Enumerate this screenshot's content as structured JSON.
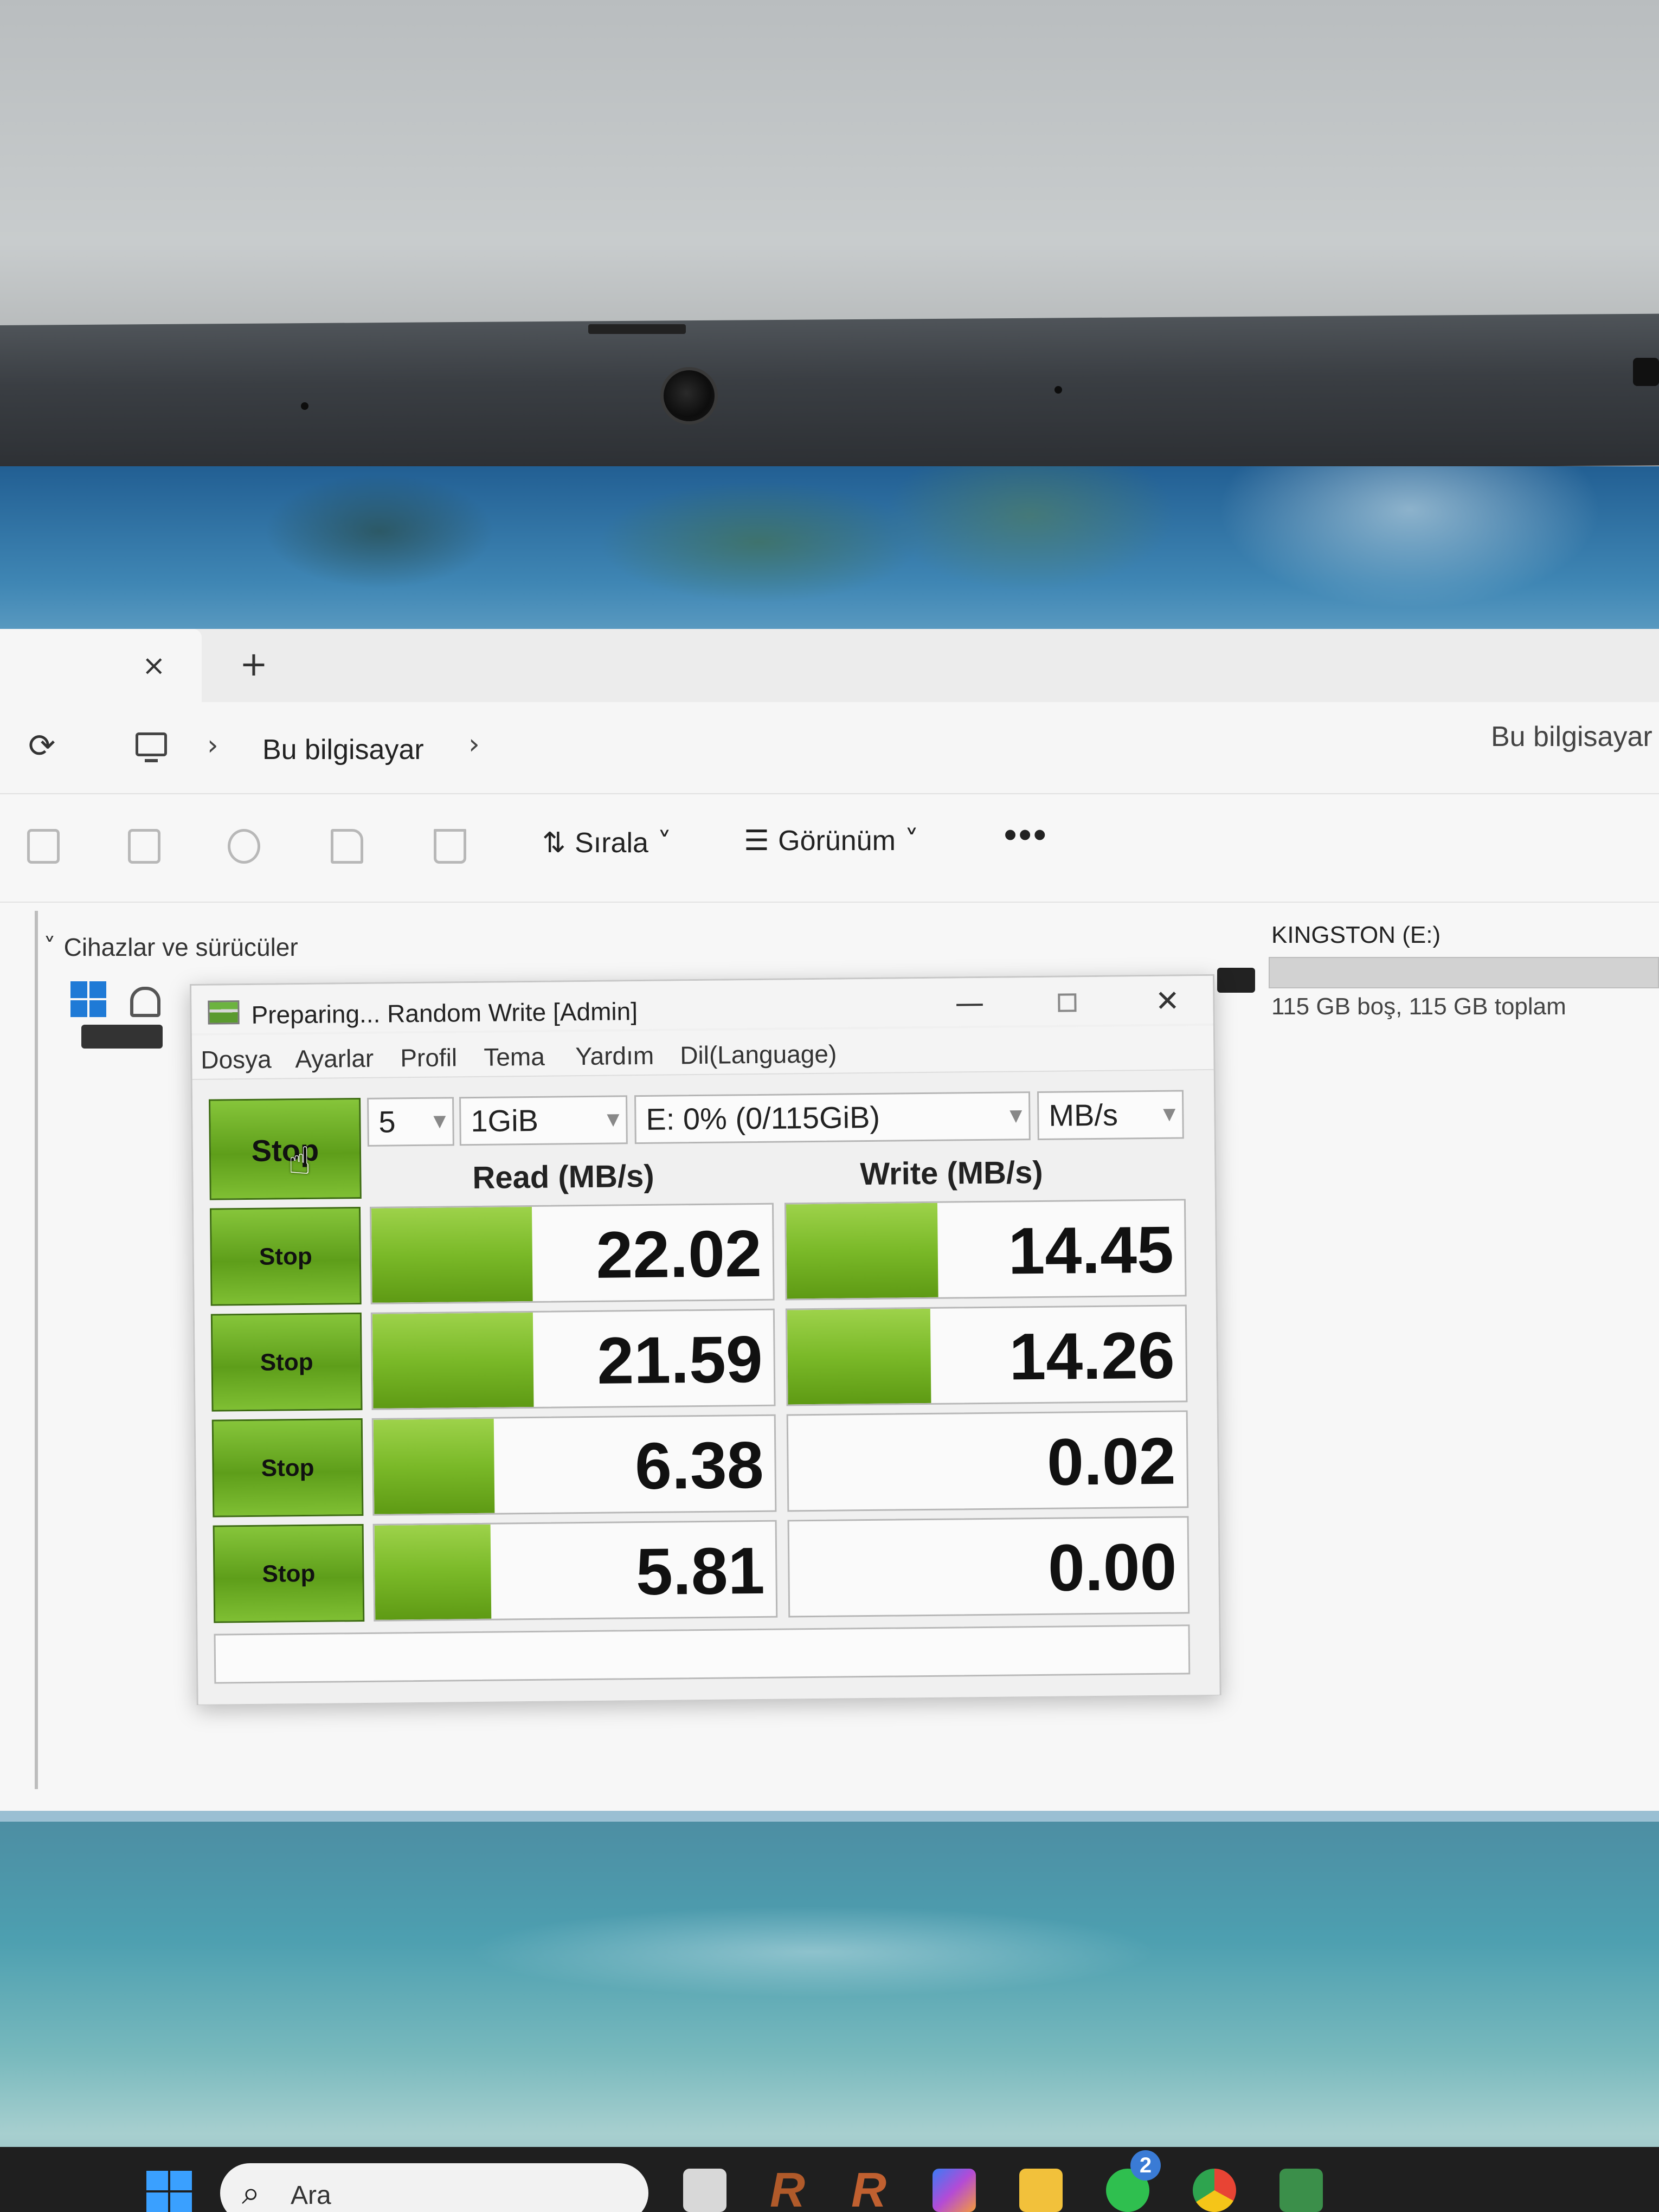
{
  "explorer": {
    "tab_close": "×",
    "tab_add": "+",
    "breadcrumb": "Bu bilgisayar",
    "search_hint": "Bu bilgisayar",
    "sort_label": "Sırala",
    "view_label": "Görünüm",
    "more_label": "•••",
    "section_title": "Cihazlar ve sürücüler",
    "drive_name": "KINGSTON (E:)",
    "drive_free": "115 GB boş, 115 GB toplam",
    "drive_usage_fraction": 0.0
  },
  "cdm": {
    "title": "Preparing... Random Write [Admin]",
    "menu": [
      "Dosya",
      "Ayarlar",
      "Profil",
      "Tema",
      "Yardım",
      "Dil(Language)"
    ],
    "main_button": "Stop",
    "count": "5",
    "size": "1GiB",
    "drive": "E: 0% (0/115GiB)",
    "unit": "MB/s",
    "read_header": "Read (MB/s)",
    "write_header": "Write (MB/s)",
    "status": "",
    "rows": [
      {
        "button": "Stop",
        "read": "22.02",
        "write": "14.45",
        "read_fill": 0.4,
        "write_fill": 0.38
      },
      {
        "button": "Stop",
        "read": "21.59",
        "write": "14.26",
        "read_fill": 0.4,
        "write_fill": 0.36
      },
      {
        "button": "Stop",
        "read": "6.38",
        "write": "0.02",
        "read_fill": 0.3,
        "write_fill": 0.0
      },
      {
        "button": "Stop",
        "read": "5.81",
        "write": "0.00",
        "read_fill": 0.29,
        "write_fill": 0.0
      }
    ]
  },
  "taskbar": {
    "search_placeholder": "Ara",
    "whatsapp_badge": "2"
  },
  "colors": {
    "accent_green": "#7ab928",
    "windows_blue": "#1f7ad6"
  },
  "icons": [
    "refresh-icon",
    "computer-icon",
    "copy-icon",
    "paste-icon",
    "rename-icon",
    "share-icon",
    "delete-icon",
    "sort-icon",
    "view-icon",
    "windows-icon",
    "lock-icon",
    "usb-drive-icon",
    "cursor-icon",
    "search-icon"
  ]
}
